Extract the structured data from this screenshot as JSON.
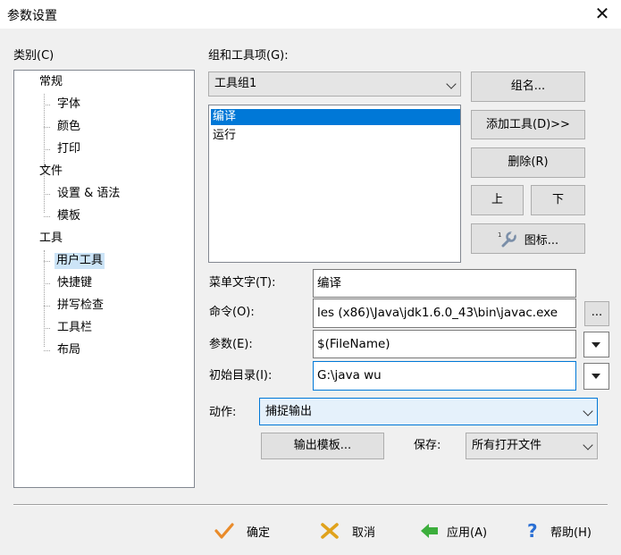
{
  "window": {
    "title": "参数设置",
    "close_glyph": "✕"
  },
  "category": {
    "label": "类别(C)",
    "tree": {
      "general": "常规",
      "font": "字体",
      "color": "颜色",
      "print": "打印",
      "file": "文件",
      "settings_syntax": "设置 & 语法",
      "template": "模板",
      "tools": "工具",
      "user_tools": "用户工具",
      "shortcuts": "快捷键",
      "spell_check": "拼写检查",
      "toolbar": "工具栏",
      "layout": "布局"
    },
    "selected": "用户工具"
  },
  "group": {
    "label": "组和工具项(G):",
    "selected_group": "工具组1",
    "items": [
      "编译",
      "运行"
    ],
    "selected_item": "编译"
  },
  "buttons": {
    "group_name": "组名...",
    "add_tool": "添加工具(D)>>",
    "delete": "删除(R)",
    "up": "上",
    "down": "下",
    "icon": "图标..."
  },
  "fields": {
    "menu_text_label": "菜单文字(T):",
    "menu_text_value": "编译",
    "command_label": "命令(O):",
    "command_value": "les (x86)\\Java\\jdk1.6.0_43\\bin\\javac.exe",
    "browse_label": "...",
    "args_label": "参数(E):",
    "args_value": "$(FileName)",
    "initdir_label": "初始目录(I):",
    "initdir_value": "G:\\java wu",
    "action_label": "动作:",
    "action_value": "捕捉输出",
    "output_template_button": "输出模板...",
    "save_label": "保存:",
    "save_value": "所有打开文件"
  },
  "footer": {
    "ok": "确定",
    "cancel": "取消",
    "apply": "应用(A)",
    "help": "帮助(H)"
  },
  "colors": {
    "selection": "#0078d7",
    "ok_icon": "#e98b2a",
    "cancel_icon": "#e0a21c",
    "apply_icon": "#3cae3c",
    "help_icon": "#2a6fd4"
  }
}
